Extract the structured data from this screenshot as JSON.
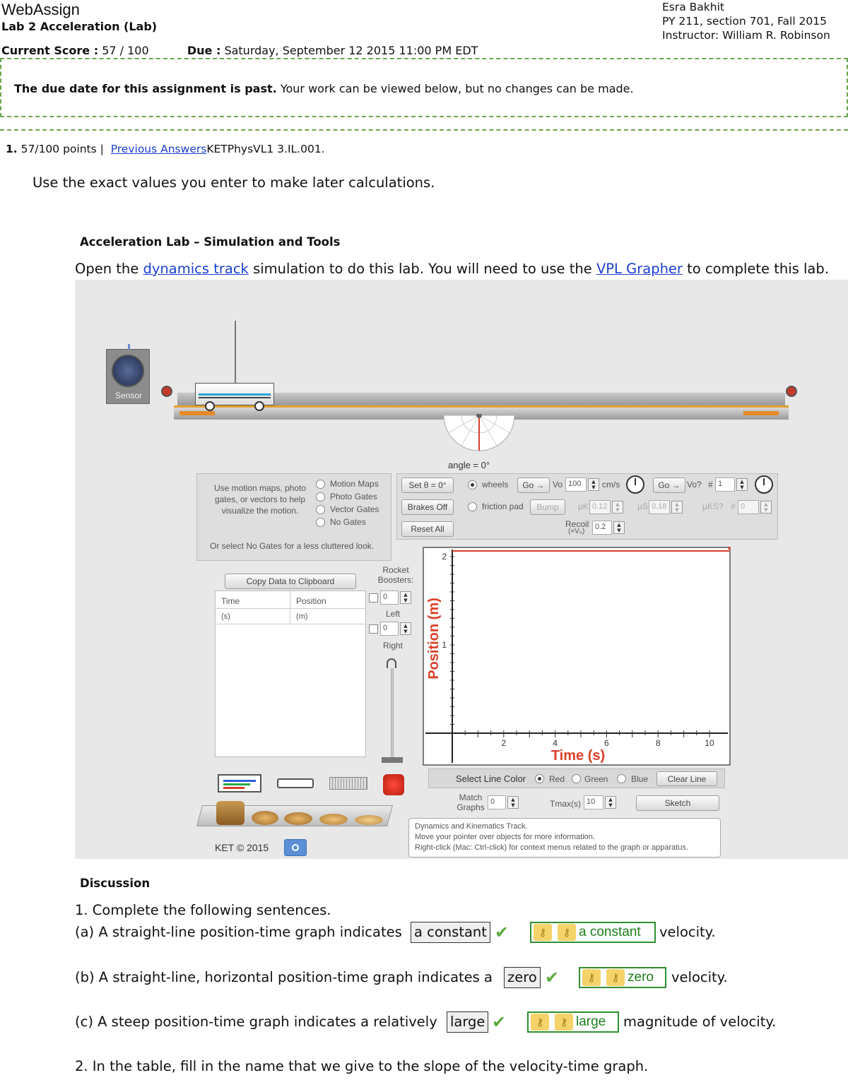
{
  "header": {
    "brand": "WebAssign",
    "assignment_title": "Lab 2 Acceleration (Lab)",
    "student_name": "Esra Bakhit",
    "course": "PY 211, section 701, Fall 2015",
    "instructor": "Instructor: William R. Robinson",
    "score_label": "Current Score :",
    "score_value": "57 / 100",
    "due_label": "Due :",
    "due_value": "Saturday, September 12 2015 11:00 PM EDT"
  },
  "notice": {
    "bold": "The due date for this assignment is past.",
    "rest": "Your work can be viewed below, but no changes can be made."
  },
  "question": {
    "number": "1.",
    "points": "57/100 points |",
    "previous_answers": "Previous Answers",
    "code": "KETPhysVL1 3.IL.001.",
    "instruction": "Use the exact values you enter to make later calculations.",
    "section_heading": "Acceleration Lab – Simulation and Tools",
    "open_prefix": "Open the",
    "open_link": "dynamics track",
    "open_middle": "simulation to do this lab. You will need to use the",
    "grapher_link": "VPL Grapher",
    "open_suffix": "to complete this lab."
  },
  "simulation": {
    "sensor_label": "Sensor",
    "angle_label": "angle = 0°",
    "motion_help": "Use motion maps, photo gates, or vectors to help visualize the motion.",
    "gate_options": [
      "Motion Maps",
      "Photo Gates",
      "Vector Gates",
      "No Gates"
    ],
    "no_gates_hint": "Or select No Gates for a less cluttered look.",
    "buttons": {
      "set_theta": "Set θ = 0°",
      "brakes_off": "Brakes Off",
      "reset_all": "Reset All",
      "go1": "Go →",
      "go2": "Go →",
      "bump": "Bump",
      "copy_data": "Copy Data to Clipboard",
      "clear_line": "Clear Line",
      "sketch": "Sketch"
    },
    "wheels_label": "wheels",
    "friction_label": "friction pad",
    "vo_label": "Vo",
    "vo_value": "100",
    "vo_unit": "cm/s",
    "vo_q_label": "Vo?",
    "hash_label": "#",
    "hash_value": "1",
    "uk_label": "μK",
    "uk_value": "0.12",
    "us_label": "μS",
    "us_value": "0.18",
    "uks_label": "μKS?",
    "uks_hash": "#",
    "uks_value": "0",
    "recoil_label": "Recoil",
    "recoil_sub": "(×V₀)",
    "recoil_value": "0.2",
    "table_headers": [
      "Time",
      "Position"
    ],
    "table_units": [
      "(s)",
      "(m)"
    ],
    "rocket_label": "Rocket Boosters:",
    "left_label": "Left",
    "right_label": "Right",
    "left_value": "0",
    "right_value": "0",
    "line_color_label": "Select Line Color",
    "colors": [
      "Red",
      "Green",
      "Blue"
    ],
    "match_label": "Match Graphs",
    "match_value": "0",
    "tmax_label": "Tmax(s)",
    "tmax_value": "10",
    "info_lines": [
      "Dynamics and Kinematics Track.",
      "Move your pointer over objects for more information.",
      "Right-click (Mac: Ctrl-click) for context menus related to the graph or apparatus."
    ],
    "copyright": "KET © 2015",
    "accent_color": "#d9402a"
  },
  "chart_data": {
    "type": "line",
    "xlabel": "Time (s)",
    "ylabel": "Position (m)",
    "xlim": [
      0,
      10
    ],
    "ylim": [
      0,
      2
    ],
    "x_ticks": [
      "2",
      "4",
      "6",
      "8",
      "10"
    ],
    "y_ticks": [
      "1",
      "2"
    ],
    "series": []
  },
  "discussion": {
    "heading": "Discussion",
    "intro": "1. Complete the following sentences.",
    "items": [
      {
        "prefix": "(a) A straight-line position-time graph indicates",
        "answer": "a constant",
        "key": "a constant",
        "suffix": "velocity."
      },
      {
        "prefix": "(b) A straight-line, horizontal position-time graph indicates a",
        "answer": "zero",
        "key": "zero",
        "suffix": "velocity."
      },
      {
        "prefix": "(c) A steep position-time graph indicates a relatively",
        "answer": "large",
        "key": "large",
        "suffix": "magnitude of velocity."
      }
    ],
    "next": "2. In the table, fill in the name that we give to the slope of the velocity-time graph."
  }
}
